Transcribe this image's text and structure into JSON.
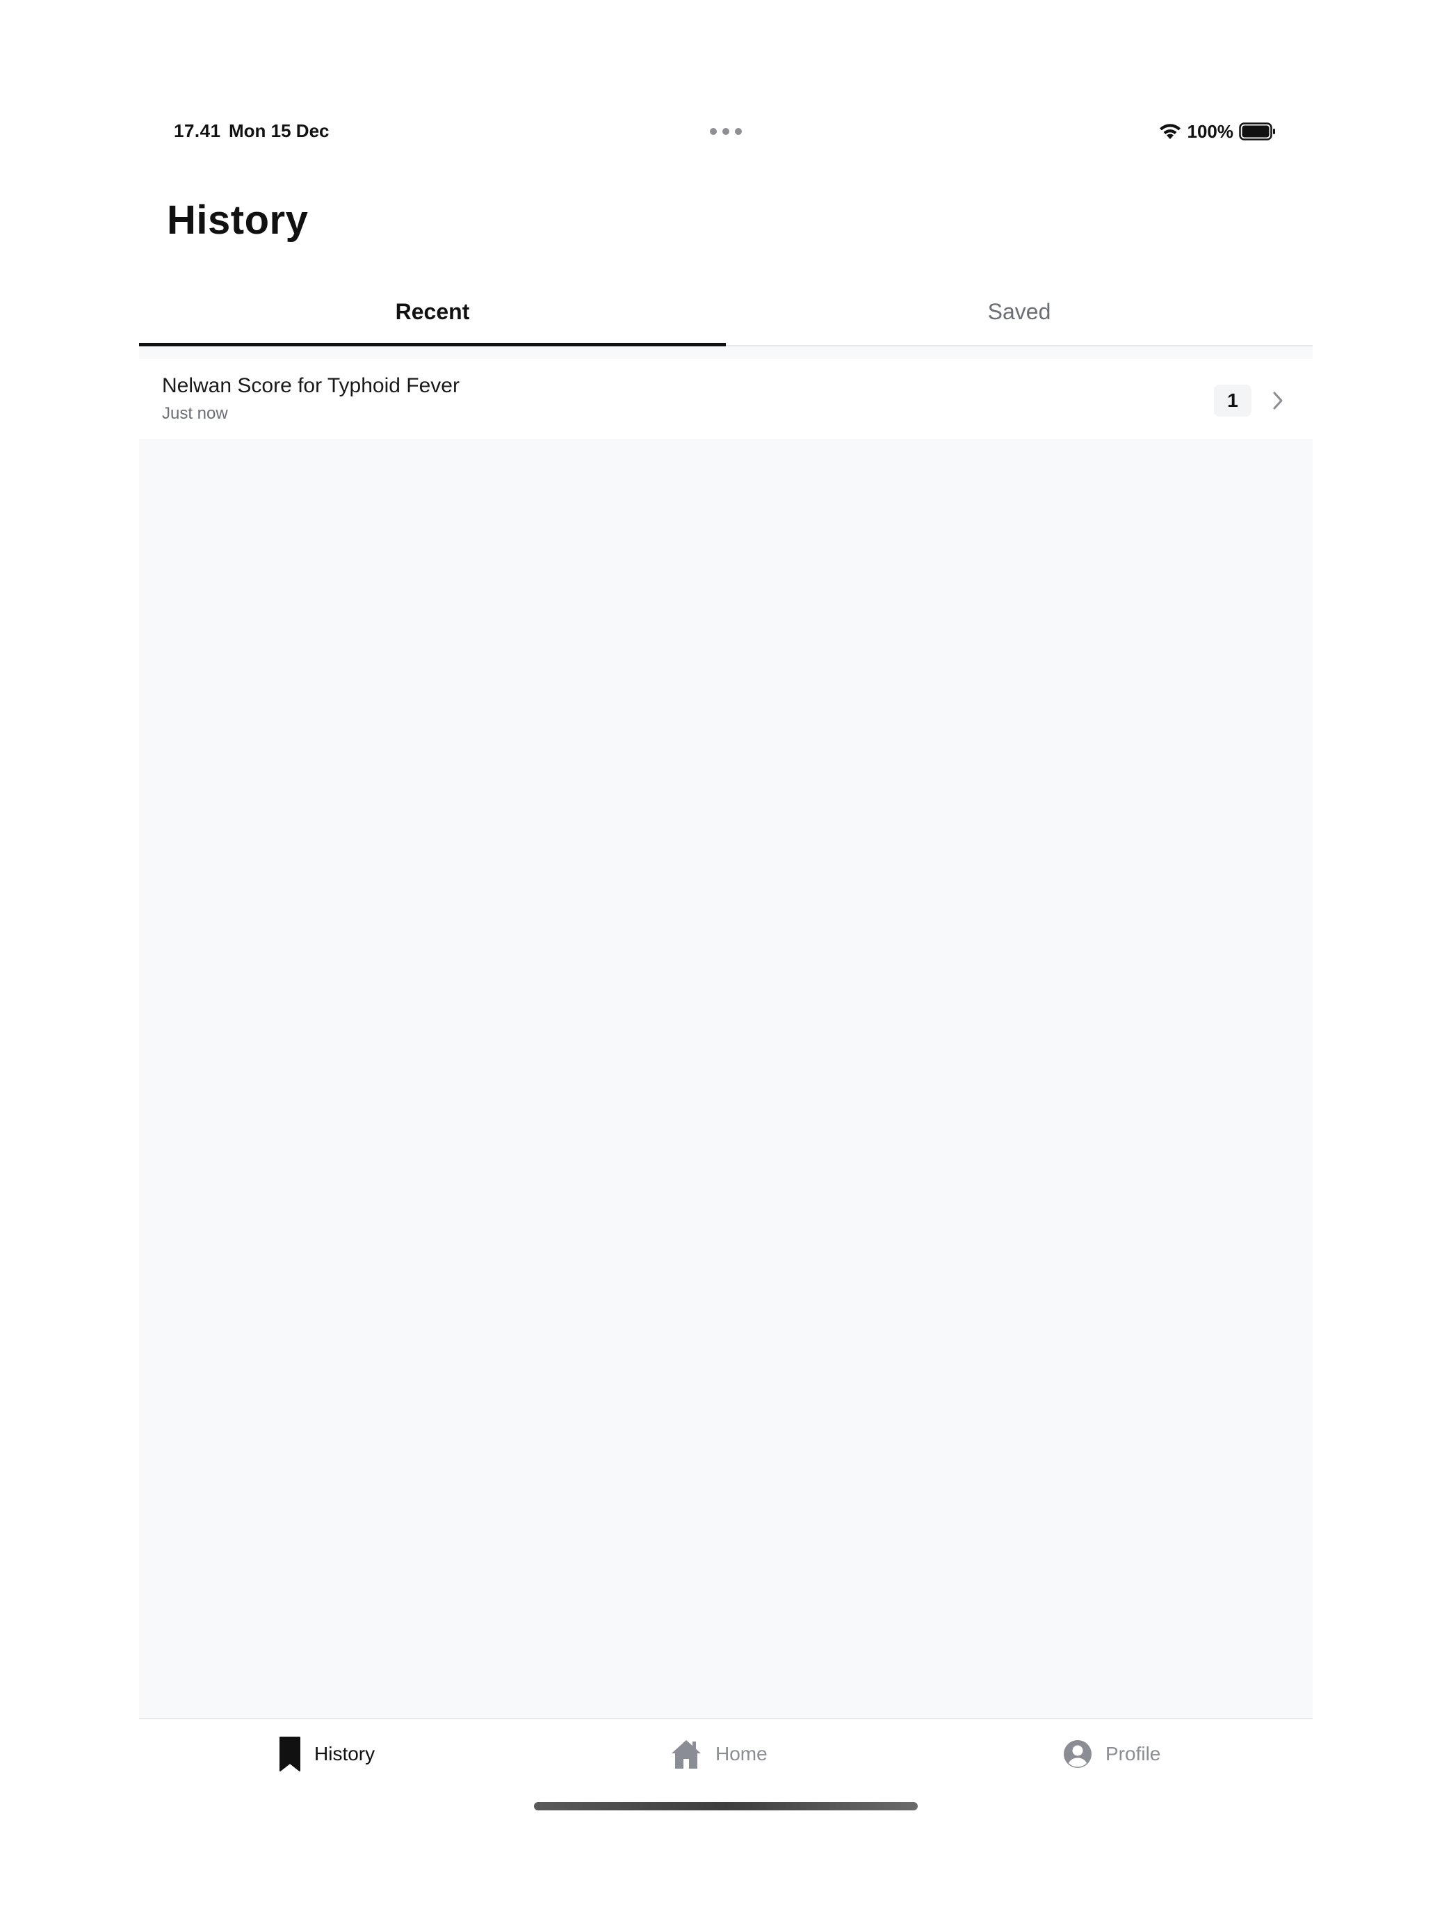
{
  "status_bar": {
    "time": "17.41",
    "date": "Mon 15 Dec",
    "battery_percent": "100%",
    "battery_level": 1.0
  },
  "header": {
    "title": "History"
  },
  "tabs": [
    {
      "label": "Recent",
      "active": true
    },
    {
      "label": "Saved",
      "active": false
    }
  ],
  "history_list": [
    {
      "title": "Nelwan Score for Typhoid Fever",
      "timestamp": "Just now",
      "score": "1"
    }
  ],
  "bottom_nav": {
    "items": [
      {
        "label": "History",
        "icon": "bookmark-icon",
        "active": true
      },
      {
        "label": "Home",
        "icon": "home-icon",
        "active": false
      },
      {
        "label": "Profile",
        "icon": "user-circle-icon",
        "active": false
      }
    ]
  },
  "colors": {
    "accent": "#111111",
    "inactive": "#8a8d93",
    "content_bg": "#f8f9fa"
  }
}
